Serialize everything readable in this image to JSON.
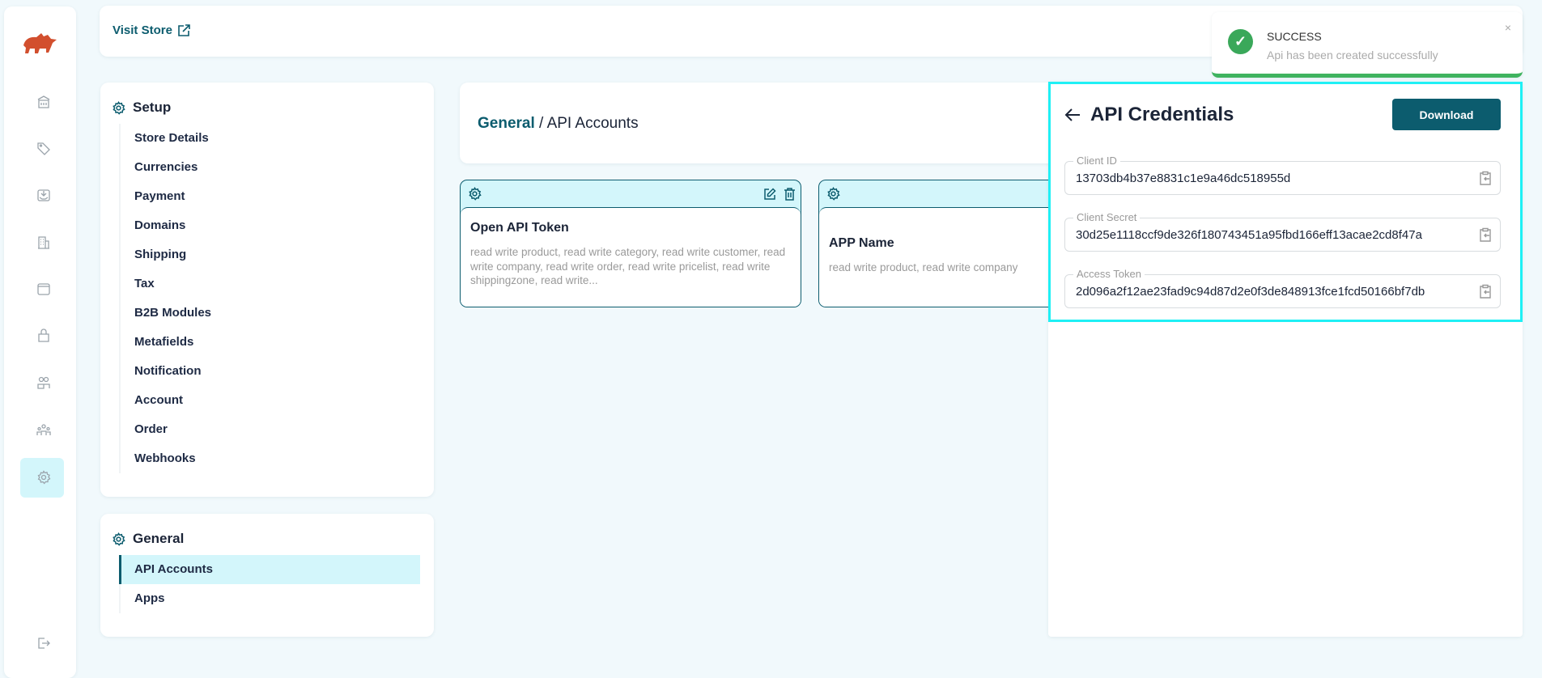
{
  "brand": {
    "logo": "rhino-logo",
    "color": "#d24f2e"
  },
  "rail": {
    "icons": [
      "bank-icon",
      "tag-icon",
      "inbox-download-icon",
      "building-icon",
      "window-icon",
      "shopping-bag-icon",
      "users-icon",
      "team-icon",
      "gear-icon"
    ],
    "logout": "logout-icon",
    "active": "gear-icon"
  },
  "topbar": {
    "visit_store": "Visit Store"
  },
  "setup": {
    "title": "Setup",
    "items": [
      "Store Details",
      "Currencies",
      "Payment",
      "Domains",
      "Shipping",
      "Tax",
      "B2B Modules",
      "Metafields",
      "Notification",
      "Account",
      "Order",
      "Webhooks"
    ]
  },
  "general": {
    "title": "General",
    "items": [
      "API Accounts",
      "Apps"
    ],
    "active": "API Accounts"
  },
  "breadcrumb": {
    "parent": "General",
    "separator": " / ",
    "current": "API Accounts"
  },
  "api_cards": [
    {
      "name": "Open API Token",
      "permissions": "read write product, read write category, read write customer, read write company, read write order, read write pricelist, read write shippingzone, read write..."
    },
    {
      "name": "APP Name",
      "permissions": "read write product, read write company"
    }
  ],
  "credentials": {
    "title": "API Credentials",
    "download": "Download",
    "fields": [
      {
        "label": "Client ID",
        "value": "13703db4b37e8831c1e9a46dc518955d"
      },
      {
        "label": "Client Secret",
        "value": "30d25e1118ccf9de326f180743451a95fbd166eff13acae2cd8f47a"
      },
      {
        "label": "Access Token",
        "value": "2d096a2f12ae23fad9c94d87d2e0f3de848913fce1fcd50166bf7db"
      }
    ]
  },
  "toast": {
    "title": "SUCCESS",
    "message": "Api has been created successfully",
    "color": "#3fb35f"
  },
  "colors": {
    "accent": "#0c5c6e",
    "highlight": "#d3f6fb"
  }
}
